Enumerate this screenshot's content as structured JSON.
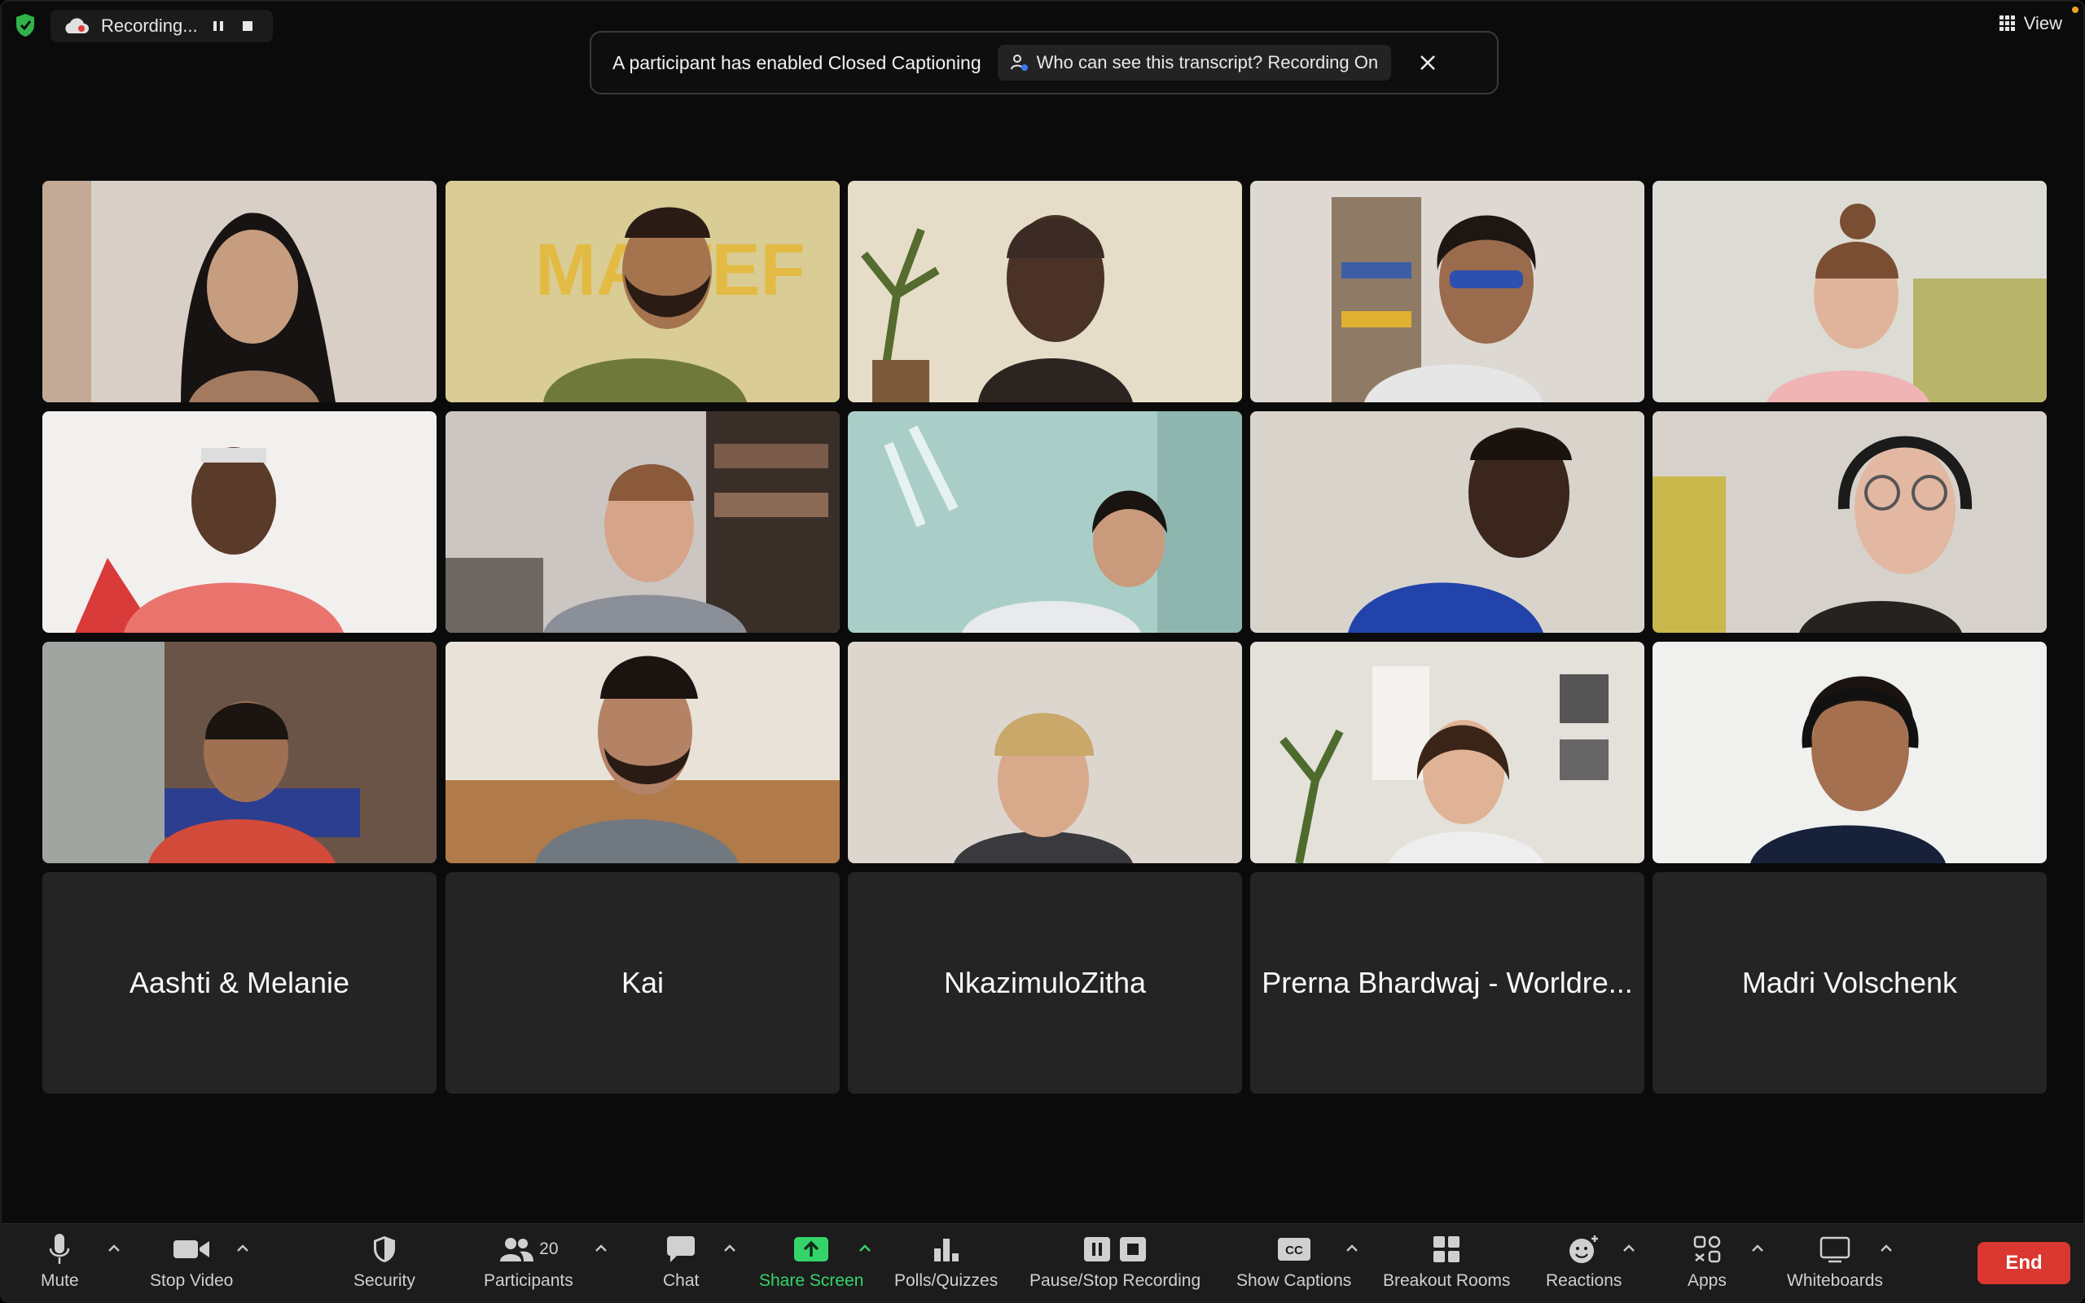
{
  "recording": {
    "label": "Recording..."
  },
  "view": {
    "label": "View"
  },
  "banner": {
    "message": "A participant has enabled Closed Captioning",
    "pill": "Who can see this transcript? Recording On"
  },
  "name_tiles": [
    "Aashti & Melanie",
    "Kai",
    "NkazimuloZitha",
    "Prerna Bhardwaj - Worldre...",
    "Madri Volschenk"
  ],
  "toolbar": {
    "mute": "Mute",
    "stop_video": "Stop Video",
    "security": "Security",
    "participants": "Participants",
    "participant_count": "20",
    "chat": "Chat",
    "share_screen": "Share Screen",
    "polls": "Polls/Quizzes",
    "recording": "Pause/Stop Recording",
    "captions": "Show Captions",
    "captions_icon_text": "CC",
    "breakout": "Breakout Rooms",
    "reactions": "Reactions",
    "apps": "Apps",
    "whiteboards": "Whiteboards",
    "end": "End"
  },
  "colors": {
    "share_green": "#35d46a",
    "active_speaker": "#5ed15b",
    "end_red": "#d9372f"
  }
}
